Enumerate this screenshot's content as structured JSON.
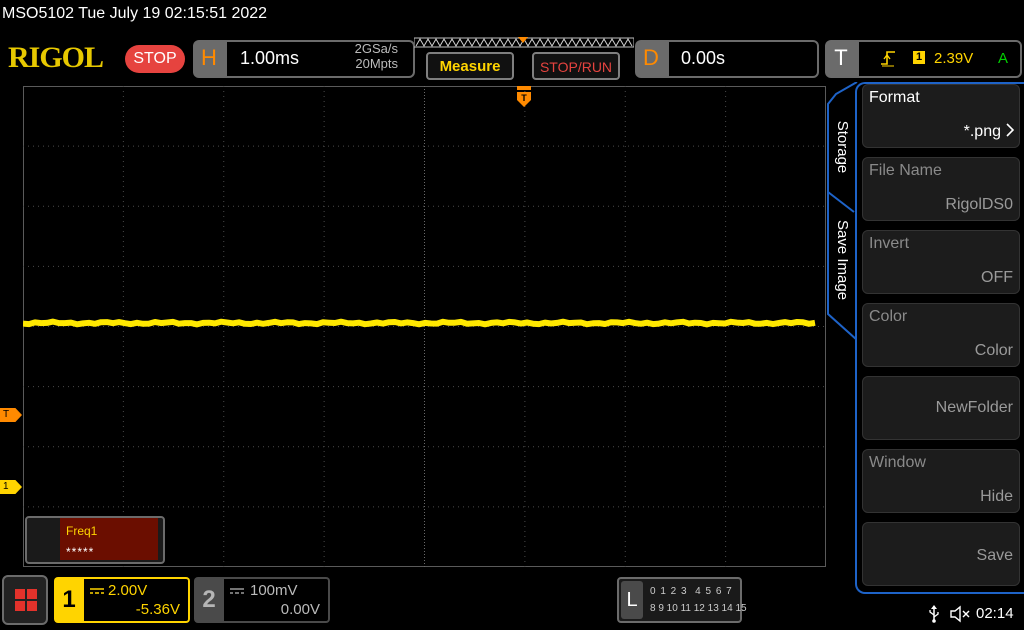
{
  "header": {
    "title_line": "MSO5102  Tue July 19 02:15:51 2022",
    "logo": "RIGOL",
    "run_state": "STOP",
    "horizontal": {
      "letter": "H",
      "timebase": "1.00ms",
      "sample_rate": "2GSa/s",
      "mem_depth": "20Mpts"
    },
    "measure_label": "Measure",
    "stoprun_label": "STOP/RUN",
    "delay": {
      "letter": "D",
      "value": "0.00s"
    },
    "trigger": {
      "letter": "T",
      "edge_icon": "rising-edge-icon",
      "source": "1",
      "level": "2.39V",
      "mode": "A"
    }
  },
  "markers": {
    "trigger_level": "T",
    "ch1_ground": "1",
    "top_trigger_icon": "trigger-position-icon"
  },
  "measurement": {
    "name": "Freq1",
    "value": "*****"
  },
  "menu": {
    "tab_labels": [
      "Storage",
      "Save Image"
    ],
    "items": [
      {
        "title": "Format",
        "value": "*.png",
        "active": true
      },
      {
        "title": "File Name",
        "value": "RigolDS0",
        "active": false
      },
      {
        "title": "Invert",
        "value": "OFF",
        "active": false
      },
      {
        "title": "Color",
        "value": "Color",
        "active": false
      },
      {
        "title": "",
        "value": "NewFolder",
        "active": false
      },
      {
        "title": "Window",
        "value": "Hide",
        "active": false
      },
      {
        "title": "",
        "value": "Save",
        "active": false
      }
    ]
  },
  "channels": {
    "ch1": {
      "number": "1",
      "scale": "2.00V",
      "offset": "-5.36V",
      "color": "#ffd400"
    },
    "ch2": {
      "number": "2",
      "scale": "100mV",
      "offset": "0.00V",
      "color": "#4a4a4a"
    }
  },
  "logic": {
    "letter": "L",
    "row1": "0 1 2 3  4 5 6 7",
    "row2": "8 9 10 11 12 13 14 15"
  },
  "status": {
    "clock": "02:14",
    "usb_icon": "usb-icon",
    "speaker_icon": "speaker-muted-icon"
  },
  "colors": {
    "accent_orange": "#ff8a00",
    "ch1_yellow": "#ffd400",
    "menu_blue": "#1e63c8",
    "stop_red": "#e6433f"
  }
}
